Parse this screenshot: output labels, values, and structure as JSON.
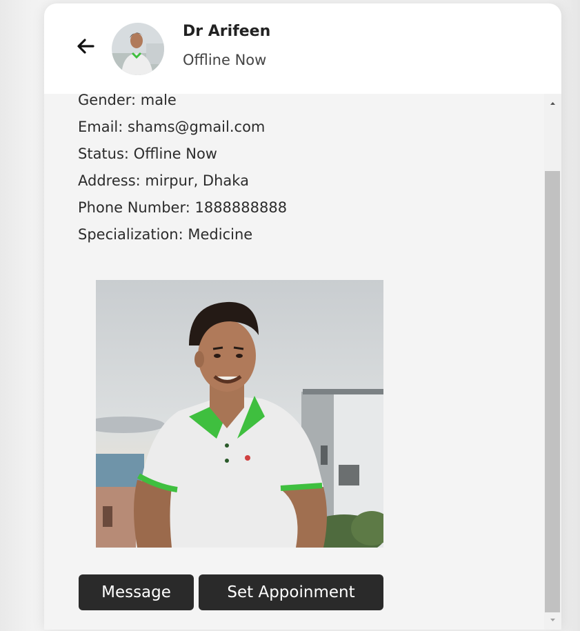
{
  "header": {
    "back_icon": "arrow-left-icon",
    "name": "Dr Arifeen",
    "status": "Offline Now"
  },
  "profile": {
    "gender": "Gender: male",
    "email": "Email: shams@gmail.com",
    "status": "Status: Offline Now",
    "address": "Address: mirpur, Dhaka",
    "phone": "Phone Number: 1888888888",
    "specialization": "Specialization: Medicine"
  },
  "actions": {
    "message_label": "Message",
    "appointment_label": "Set Appoinment"
  },
  "colors": {
    "button_bg": "#2a2a2a",
    "button_text": "#ffffff",
    "shirt_accent": "#3fbf3f"
  },
  "scrollbar": {
    "scroll_fraction_top": 0.14
  }
}
